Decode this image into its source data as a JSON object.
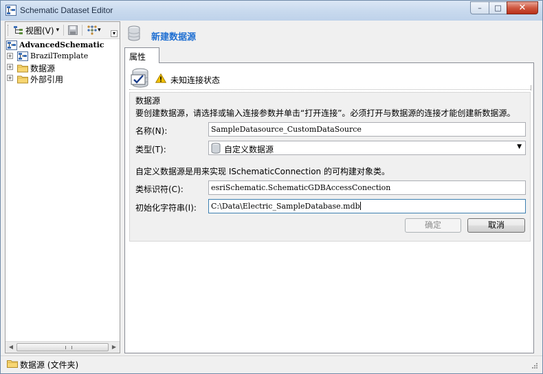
{
  "window": {
    "title": "Schematic Dataset Editor",
    "controls": {
      "minimize": "–",
      "maximize": "□",
      "close": "✕"
    }
  },
  "left_toolbar": {
    "view_label": "视图(V)",
    "view_arrow": "▾",
    "layout_arrow": "▾"
  },
  "tree": {
    "items": [
      {
        "label": "AdvancedSchematic",
        "expander": "",
        "icon": "schematic-dataset-icon"
      },
      {
        "label": "BrazilTemplate",
        "expander": "+",
        "icon": "schematic-template-icon"
      },
      {
        "label": "数据源",
        "expander": "+",
        "icon": "folder-icon"
      },
      {
        "label": "外部引用",
        "expander": "+",
        "icon": "folder-icon"
      }
    ]
  },
  "scroll": {
    "left_arrow": "◀",
    "right_arrow": "▶"
  },
  "panel": {
    "header_title": "新建数据源",
    "tab_label": "属性",
    "status_text": "未知连接状态",
    "section_title": "数据源",
    "section_description": "要创建数据源，请选择或输入连接参数并单击“打开连接”。必须打开与数据源的连接才能创建新数据源。",
    "fields": {
      "name_label": "名称(N):",
      "name_value": "SampleDatasource_CustomDataSource",
      "type_label": "类型(T):",
      "type_value": "自定义数据源",
      "type_arrow": "▼",
      "custom_description": "自定义数据源是用来实现 ISchematicConnection 的可构建对象类。",
      "class_id_label": "类标识符(C):",
      "class_id_value": "esriSchematic.SchematicGDBAccessConection",
      "init_string_label": "初始化字符串(I):",
      "init_string_value": "C:\\Data\\Electric_SampleDatabase.mdb"
    },
    "buttons": {
      "ok": "确定",
      "cancel": "取消"
    }
  },
  "statusbar": {
    "text": "数据源 (文件夹)"
  },
  "colors": {
    "header_title": "#1f6fd2",
    "warning": "#f3c200",
    "close_button": "#c7432c"
  }
}
